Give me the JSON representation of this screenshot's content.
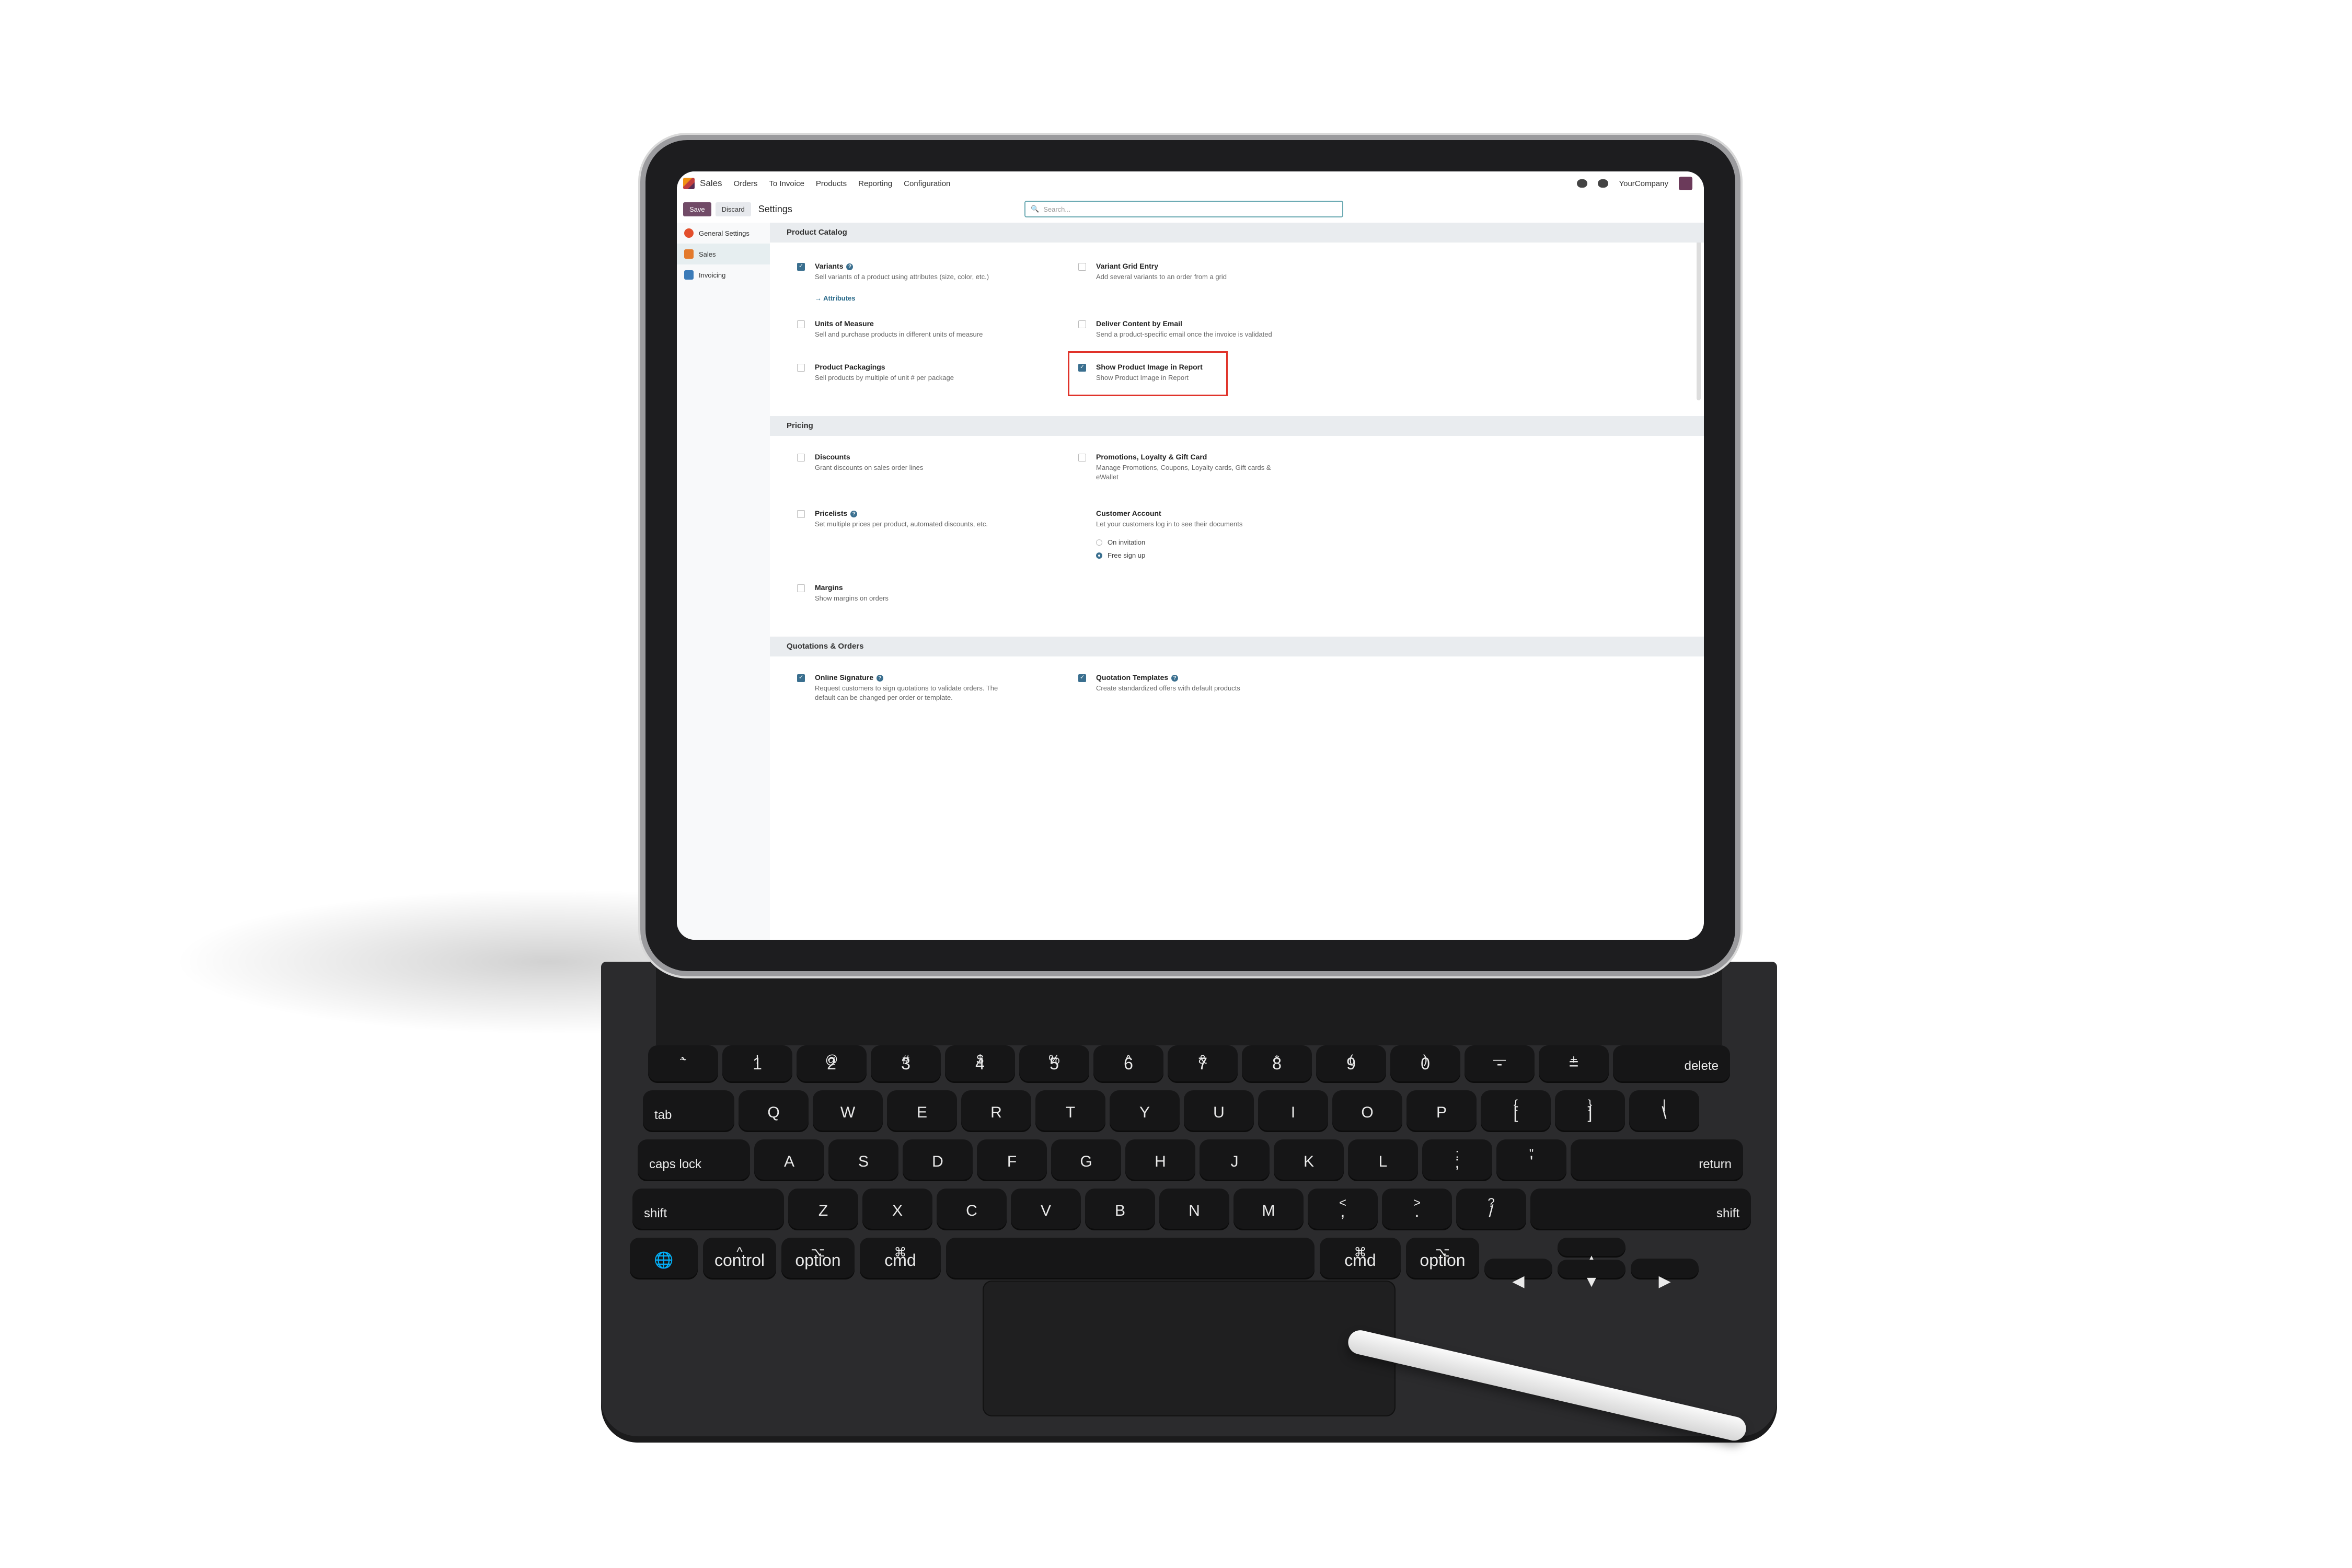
{
  "topnav": {
    "app_name": "Sales",
    "menu": [
      "Orders",
      "To Invoice",
      "Products",
      "Reporting",
      "Configuration"
    ],
    "company": "YourCompany",
    "chat_badge": "",
    "activity_badge": ""
  },
  "control_panel": {
    "save_label": "Save",
    "discard_label": "Discard",
    "title": "Settings",
    "search_placeholder": "Search..."
  },
  "sidebar": {
    "items": [
      {
        "label": "General Settings"
      },
      {
        "label": "Sales"
      },
      {
        "label": "Invoicing"
      }
    ]
  },
  "sections": {
    "product_catalog": {
      "title": "Product Catalog",
      "variants": {
        "label": "Variants",
        "desc": "Sell variants of a product using attributes (size, color, etc.)",
        "link": "→ Attributes",
        "checked": true
      },
      "variant_grid": {
        "label": "Variant Grid Entry",
        "desc": "Add several variants to an order from a grid",
        "checked": false
      },
      "uom": {
        "label": "Units of Measure",
        "desc": "Sell and purchase products in different units of measure",
        "checked": false
      },
      "deliver_content": {
        "label": "Deliver Content by Email",
        "desc": "Send a product-specific email once the invoice is validated",
        "checked": false
      },
      "packagings": {
        "label": "Product Packagings",
        "desc": "Sell products by multiple of unit # per package",
        "checked": false
      },
      "product_image": {
        "label": "Show Product Image in Report",
        "desc": "Show Product Image in Report",
        "checked": true
      }
    },
    "pricing": {
      "title": "Pricing",
      "discounts": {
        "label": "Discounts",
        "desc": "Grant discounts on sales order lines",
        "checked": false
      },
      "promotions": {
        "label": "Promotions, Loyalty & Gift Card",
        "desc": "Manage Promotions, Coupons, Loyalty cards, Gift cards & eWallet",
        "checked": false
      },
      "pricelists": {
        "label": "Pricelists",
        "desc": "Set multiple prices per product, automated discounts, etc.",
        "checked": false
      },
      "customer_account": {
        "label": "Customer Account",
        "desc": "Let your customers log in to see their documents",
        "options": [
          "On invitation",
          "Free sign up"
        ],
        "selected": "Free sign up"
      },
      "margins": {
        "label": "Margins",
        "desc": "Show margins on orders",
        "checked": false
      }
    },
    "quotations": {
      "title": "Quotations & Orders",
      "online_signature": {
        "label": "Online Signature",
        "desc": "Request customers to sign quotations to validate orders. The default can be changed per order or template.",
        "checked": true
      },
      "templates": {
        "label": "Quotation Templates",
        "desc": "Create standardized offers with default products",
        "checked": true
      }
    }
  },
  "keyboard": {
    "row1": [
      [
        "~",
        "`"
      ],
      [
        "!",
        "1"
      ],
      [
        "@",
        "2"
      ],
      [
        "#",
        "3"
      ],
      [
        "$",
        "4"
      ],
      [
        "%",
        "5"
      ],
      [
        "^",
        "6"
      ],
      [
        "&",
        "7"
      ],
      [
        "*",
        "8"
      ],
      [
        "(",
        "9"
      ],
      [
        ")",
        "0"
      ],
      [
        "—",
        "-"
      ],
      [
        "+",
        "="
      ]
    ],
    "delete": "delete",
    "tab": "tab",
    "row2": [
      "Q",
      "W",
      "E",
      "R",
      "T",
      "Y",
      "U",
      "I",
      "O",
      "P"
    ],
    "row2_extra": [
      [
        "{",
        "["
      ],
      [
        "}",
        "]"
      ],
      [
        "|",
        "\\"
      ]
    ],
    "caps": "caps lock",
    "row3": [
      "A",
      "S",
      "D",
      "F",
      "G",
      "H",
      "J",
      "K",
      "L"
    ],
    "row3_extra": [
      [
        ":",
        ";"
      ],
      [
        "\"",
        "'"
      ]
    ],
    "return": "return",
    "shift": "shift",
    "row4": [
      "Z",
      "X",
      "C",
      "V",
      "B",
      "N",
      "M"
    ],
    "row4_extra": [
      [
        "<",
        ","
      ],
      [
        ">",
        "."
      ],
      [
        "?",
        "/"
      ]
    ],
    "bottom": {
      "control": "control",
      "option": "option",
      "cmd": "cmd",
      "control_sym": "^",
      "option_sym": "⌥",
      "cmd_sym": "⌘"
    }
  },
  "colors": {
    "brand": "#714b67",
    "highlight": "#e0332a",
    "accent": "#3a6f8f"
  }
}
